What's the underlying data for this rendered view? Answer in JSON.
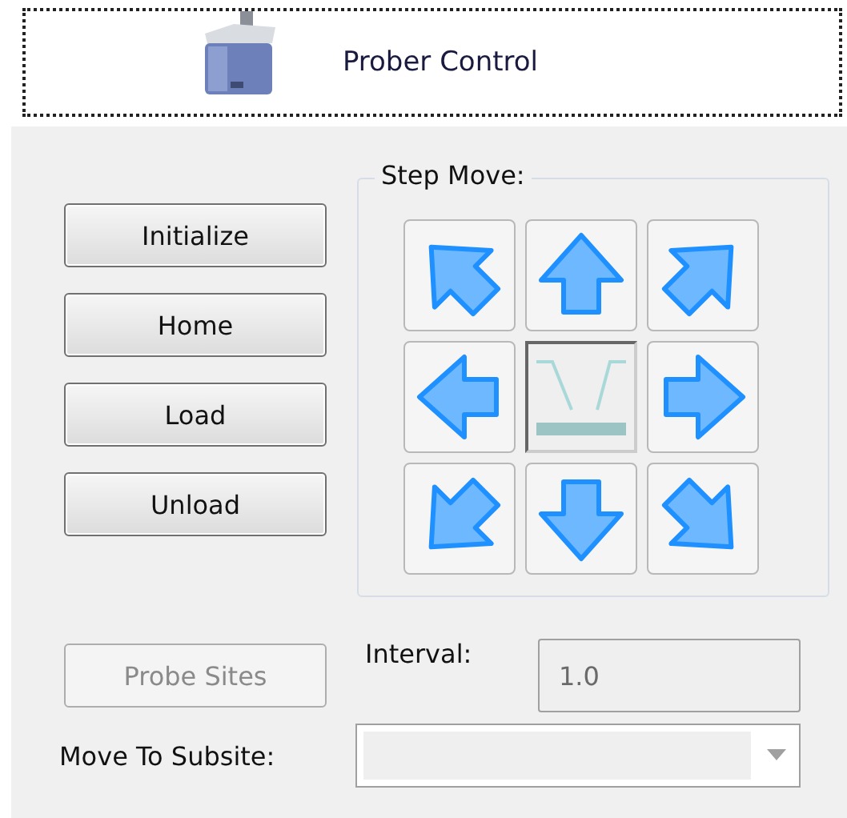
{
  "header": {
    "title": "Prober Control"
  },
  "actions": [
    {
      "label": "Initialize",
      "disabled": false
    },
    {
      "label": "Home",
      "disabled": false
    },
    {
      "label": "Load",
      "disabled": false
    },
    {
      "label": "Unload",
      "disabled": false
    }
  ],
  "step_move": {
    "label": "Step Move:"
  },
  "probe_sites": {
    "label": "Probe Sites",
    "disabled": true
  },
  "interval": {
    "label": "Interval:",
    "value": "1.0",
    "disabled": true
  },
  "subsite": {
    "label": "Move To Subsite:",
    "disabled": true
  }
}
